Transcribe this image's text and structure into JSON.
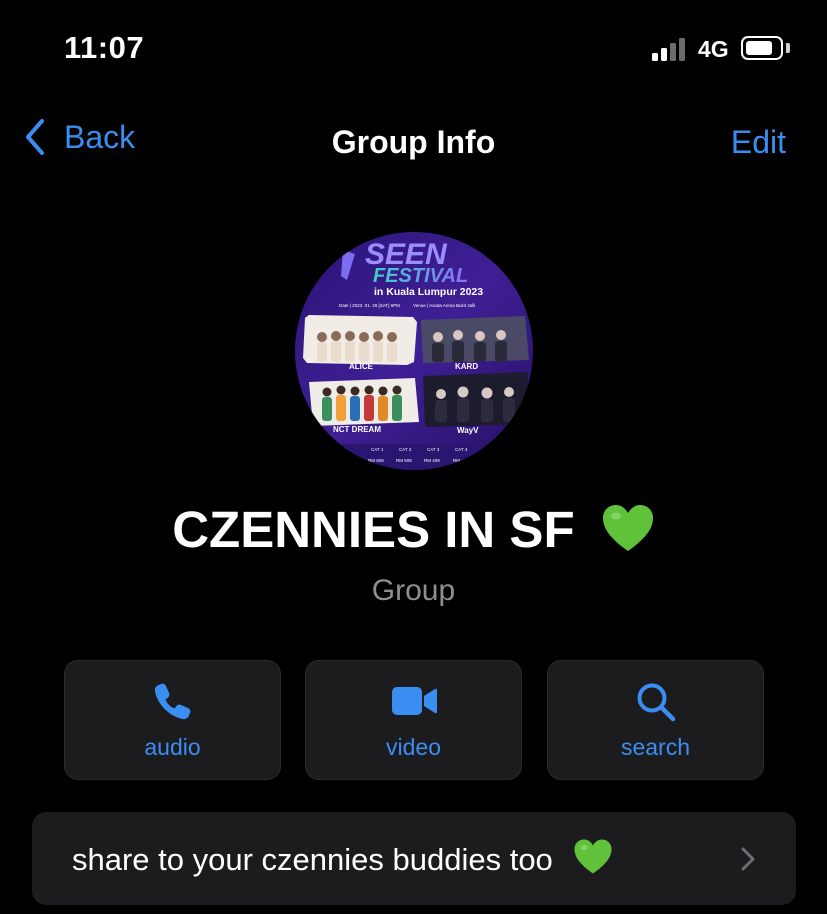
{
  "status_bar": {
    "time": "11:07",
    "network": "4G",
    "signal_icon": "cellular-signal-icon",
    "battery_icon": "battery-icon",
    "battery_level": 0.85
  },
  "nav": {
    "back_label": "Back",
    "title": "Group Info",
    "edit_label": "Edit",
    "back_icon": "chevron-left-icon"
  },
  "avatar": {
    "title_line1": "SEEN",
    "title_line2": "FESTIVAL",
    "title_line3": "in Kuala Lumpur 2023",
    "date_text": "Date | 2023. 01. 28 [SAT] 6PM",
    "venue_text": "Venue | Axiata Arena Bukit Jalil",
    "acts": [
      "ALICE",
      "KARD",
      "NCT DREAM",
      "WayV"
    ],
    "price_categories": [
      "VIP",
      "CAT 1",
      "CAT 2",
      "CAT 3",
      "CAT 4"
    ],
    "prices": [
      "RM",
      "RM 608",
      "RM 508",
      "RM 408",
      "RM"
    ]
  },
  "group": {
    "name": "CZENNIES IN SF",
    "name_emoji_icon": "green-heart-icon",
    "subtitle": "Group"
  },
  "actions": [
    {
      "label": "audio",
      "icon": "phone-icon"
    },
    {
      "label": "video",
      "icon": "video-camera-icon"
    },
    {
      "label": "search",
      "icon": "search-icon"
    }
  ],
  "description": {
    "text": "share to your czennies buddies too",
    "emoji_icon": "green-heart-icon",
    "chevron_icon": "chevron-right-icon"
  },
  "colors": {
    "background": "#000000",
    "accent": "#3a8ef2",
    "card": "#1c1c1e",
    "secondary_text": "#8e8e93",
    "heart": "#5fc23a",
    "poster_purple": "#3a1d8c"
  }
}
